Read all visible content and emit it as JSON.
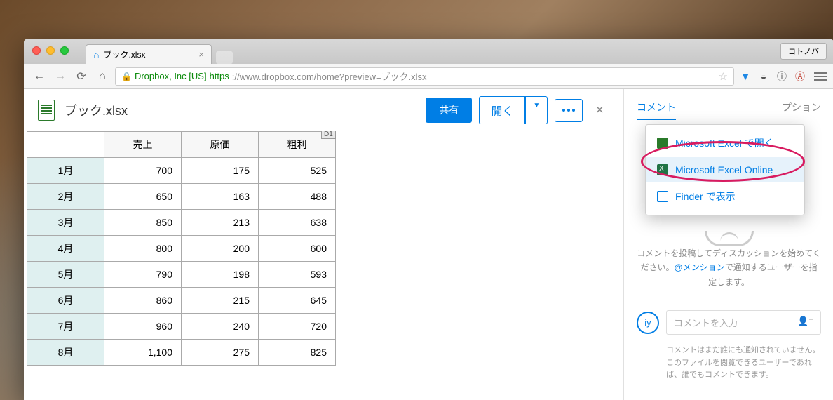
{
  "browser": {
    "tab_title": "ブック.xlsx",
    "user_button": "コトノバ",
    "ev_cert": "Dropbox, Inc [US]",
    "url_prefix": "https",
    "url_rest": "://www.dropbox.com/home?preview=ブック.xlsx"
  },
  "file": {
    "title": "ブック.xlsx",
    "share_button": "共有",
    "open_button": "開く",
    "cell_ref": "D1"
  },
  "open_menu": {
    "items": [
      {
        "label": "Microsoft Excel で開く",
        "icon": "excel"
      },
      {
        "label": "Microsoft Excel Online",
        "icon": "excel-online"
      },
      {
        "label": "Finder で表示",
        "icon": "finder"
      }
    ]
  },
  "spreadsheet": {
    "columns": [
      "売上",
      "原価",
      "粗利"
    ],
    "rows": [
      {
        "label": "1月",
        "values": [
          "700",
          "175",
          "525"
        ]
      },
      {
        "label": "2月",
        "values": [
          "650",
          "163",
          "488"
        ]
      },
      {
        "label": "3月",
        "values": [
          "850",
          "213",
          "638"
        ]
      },
      {
        "label": "4月",
        "values": [
          "800",
          "200",
          "600"
        ]
      },
      {
        "label": "5月",
        "values": [
          "790",
          "198",
          "593"
        ]
      },
      {
        "label": "6月",
        "values": [
          "860",
          "215",
          "645"
        ]
      },
      {
        "label": "7月",
        "values": [
          "960",
          "240",
          "720"
        ]
      },
      {
        "label": "8月",
        "values": [
          "1,100",
          "275",
          "825"
        ]
      }
    ]
  },
  "side": {
    "tab_comments": "コメント",
    "tab_options": "プション",
    "empty_text_1": "コメントを投稿してディスカッションを始めてください。",
    "mention": "@メンション",
    "empty_text_2": "で通知するユーザーを指定します。",
    "avatar_initials": "iy",
    "input_placeholder": "コメントを入力",
    "note": "コメントはまだ誰にも通知されていません。このファイルを閲覧できるユーザーであれば、誰でもコメントできます。"
  }
}
